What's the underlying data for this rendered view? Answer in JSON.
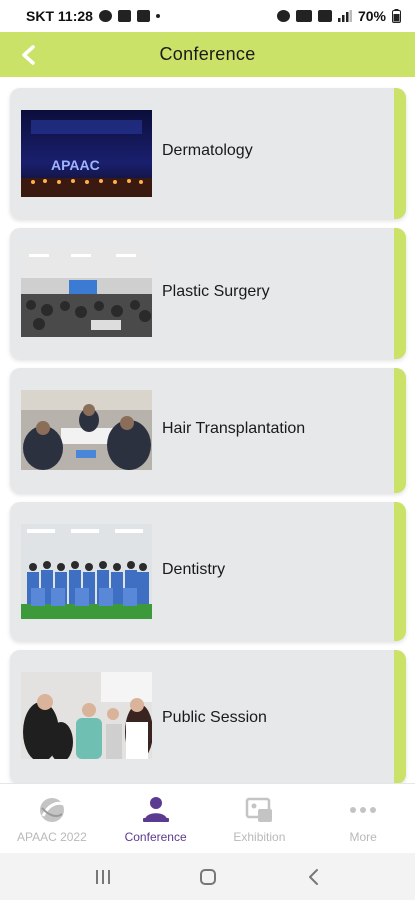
{
  "status_bar": {
    "carrier_time": "SKT 11:28",
    "battery": "70%"
  },
  "header": {
    "title": "Conference",
    "back_icon": "chevron-left-icon"
  },
  "conferences": [
    {
      "label": "Dermatology",
      "image": "stage-banner-photo"
    },
    {
      "label": "Plastic Surgery",
      "image": "lecture-hall-photo"
    },
    {
      "label": "Hair Transplantation",
      "image": "workshop-photo"
    },
    {
      "label": "Dentistry",
      "image": "group-photo"
    },
    {
      "label": "Public Session",
      "image": "crowd-photo"
    }
  ],
  "bottom_nav": [
    {
      "label": "APAAC 2022",
      "icon": "apaac-logo-icon",
      "active": false
    },
    {
      "label": "Conference",
      "icon": "conference-icon",
      "active": true
    },
    {
      "label": "Exhibition",
      "icon": "exhibition-icon",
      "active": false
    },
    {
      "label": "More",
      "icon": "more-icon",
      "active": false
    }
  ],
  "colors": {
    "accent_green": "#c9e267",
    "active_purple": "#5b3a91",
    "card_bg": "#e7e8ea",
    "inactive_gray": "#b9b9b9"
  }
}
